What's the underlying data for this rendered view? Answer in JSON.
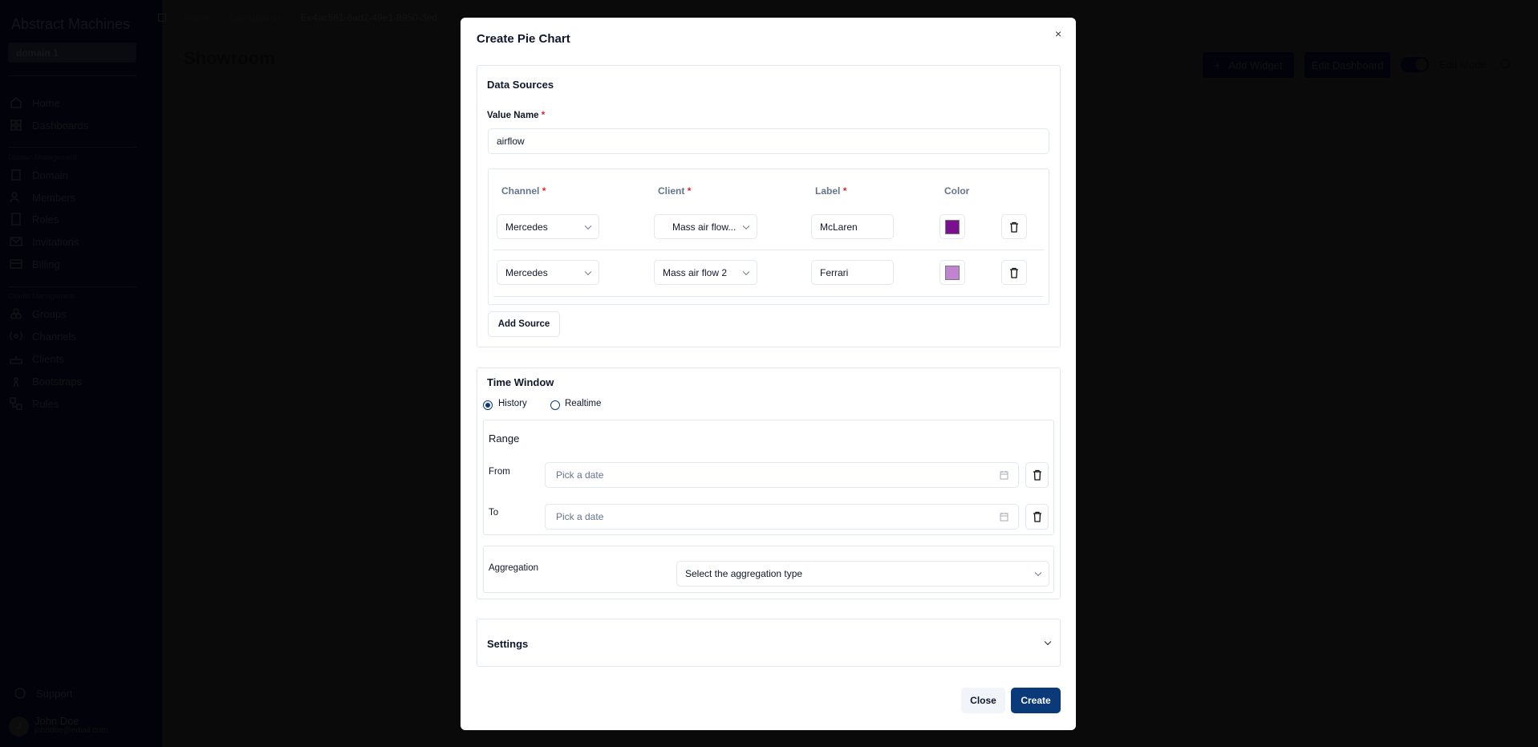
{
  "sidebar": {
    "logo": "Abstract Machines",
    "domain_select": "domain 1",
    "nav": [
      {
        "label": "Home",
        "icon": "home-icon"
      },
      {
        "label": "Dashboards",
        "icon": "dashboard-icon"
      }
    ],
    "domain_section": "Domain Management",
    "domain_items": [
      {
        "label": "Domain",
        "icon": "building-icon"
      },
      {
        "label": "Members",
        "icon": "users-icon"
      },
      {
        "label": "Roles",
        "icon": "notebook-icon"
      },
      {
        "label": "Invitations",
        "icon": "mail-icon"
      },
      {
        "label": "Billing",
        "icon": "credit-card-icon"
      }
    ],
    "clients_section": "Clients Management",
    "clients_items": [
      {
        "label": "Groups",
        "icon": "groups-icon"
      },
      {
        "label": "Channels",
        "icon": "radio-icon"
      },
      {
        "label": "Clients",
        "icon": "router-icon"
      },
      {
        "label": "Bootstraps",
        "icon": "antenna-icon"
      },
      {
        "label": "Rules",
        "icon": "workflow-icon"
      }
    ],
    "support": "Support",
    "user": {
      "initial": "J",
      "name": "John Doe",
      "email": "johndoe@email.com"
    }
  },
  "header": {
    "breadcrumbs": [
      "Home",
      "Dashboards",
      "Ee4ac561-6ad2-49e1-8950-3ed"
    ],
    "title": "Showroom",
    "add_widget": "Add Widget",
    "edit_dashboard": "Edit Dashboard",
    "edit_mode": "Edit Mode",
    "edit_mode_on": true
  },
  "modal": {
    "title": "Create Pie Chart",
    "data_sources": {
      "title": "Data Sources",
      "value_name_label": "Value Name",
      "value_name": "airflow",
      "columns": [
        "Channel",
        "Client",
        "Label",
        "Color"
      ],
      "rows": [
        {
          "channel": "Mercedes",
          "client": "Mass air flow...",
          "label": "McLaren",
          "color": "#7a0f8f"
        },
        {
          "channel": "Mercedes",
          "client": "Mass air flow 2",
          "label": "Ferrari",
          "color": "#c084d0"
        }
      ],
      "add_source": "Add Source"
    },
    "time_window": {
      "title": "Time Window",
      "options": [
        "History",
        "Realtime"
      ],
      "selected": "History",
      "range_label": "Range",
      "from_label": "From",
      "to_label": "To",
      "from_placeholder": "Pick a date",
      "to_placeholder": "Pick a date",
      "aggregation_label": "Aggregation",
      "aggregation_placeholder": "Select the aggregation type"
    },
    "settings": "Settings",
    "close": "Close",
    "create": "Create",
    "accent": "#0b3a7a"
  }
}
